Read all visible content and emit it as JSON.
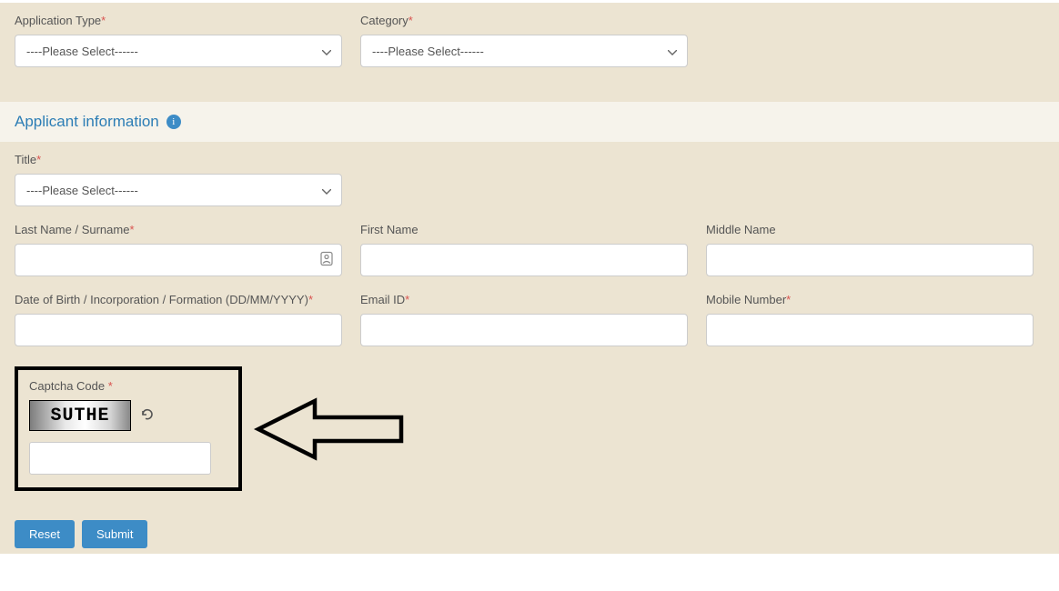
{
  "top": {
    "appType": {
      "label": "Application Type",
      "placeholder": "----Please Select------"
    },
    "category": {
      "label": "Category",
      "placeholder": "----Please Select------"
    }
  },
  "sectionTitle": "Applicant information",
  "applicant": {
    "title": {
      "label": "Title",
      "placeholder": "----Please Select------"
    },
    "lastName": {
      "label": "Last Name / Surname"
    },
    "firstName": {
      "label": "First Name"
    },
    "middleName": {
      "label": "Middle Name"
    },
    "dob": {
      "label": "Date of Birth / Incorporation / Formation (DD/MM/YYYY)"
    },
    "email": {
      "label": "Email ID"
    },
    "mobile": {
      "label": "Mobile Number"
    }
  },
  "captcha": {
    "label": "Captcha Code ",
    "text": "SUTHE"
  },
  "buttons": {
    "reset": "Reset",
    "submit": "Submit"
  },
  "required": "*"
}
